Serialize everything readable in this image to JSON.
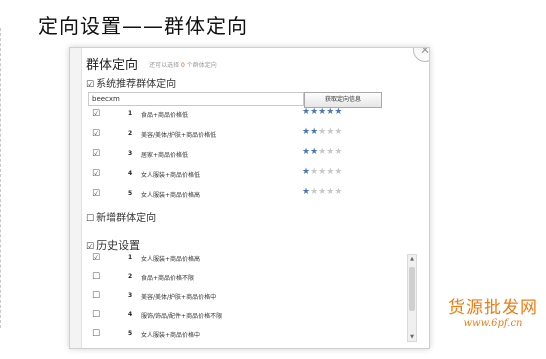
{
  "slide": {
    "title": "定向设置——群体定向"
  },
  "dialog": {
    "title": "群体定向",
    "hint_prefix": "还可以选择",
    "hint_count": "0",
    "hint_suffix": "个群体定向",
    "close_icon": "close-icon",
    "recommend": {
      "checkbox": "☑",
      "label": "系统推荐群体定向",
      "search_value": "beecxm",
      "fetch_button": "获取定向信息",
      "rows": [
        {
          "checkbox": "☑",
          "rank": "1",
          "label": "食品+商品价格低",
          "stars": 5
        },
        {
          "checkbox": "☑",
          "rank": "2",
          "label": "美容/美体/护肤+商品价格低",
          "stars": 2
        },
        {
          "checkbox": "☑",
          "rank": "3",
          "label": "居家+商品价格低",
          "stars": 2
        },
        {
          "checkbox": "☑",
          "rank": "4",
          "label": "女人服装+商品价格低",
          "stars": 1
        },
        {
          "checkbox": "☑",
          "rank": "5",
          "label": "女人服装+商品价格高",
          "stars": 1
        }
      ],
      "max_stars": 5
    },
    "new_group": {
      "checkbox": "☐",
      "label": "新增群体定向"
    },
    "history": {
      "checkbox": "☑",
      "label": "历史设置",
      "rows": [
        {
          "checkbox": "☑",
          "rank": "1",
          "label": "女人服装+商品价格高"
        },
        {
          "checkbox": "☐",
          "rank": "2",
          "label": "食品+商品价格不限"
        },
        {
          "checkbox": "☐",
          "rank": "3",
          "label": "美容/美体/护肤+商品价格中"
        },
        {
          "checkbox": "☐",
          "rank": "4",
          "label": "服饰/饰品/配件+商品价格不限"
        },
        {
          "checkbox": "☐",
          "rank": "5",
          "label": "女人服装+商品价格中"
        }
      ]
    }
  },
  "colors": {
    "star_on": "#4a76b8",
    "star_off": "#c8c8c8",
    "watermark": "#f07b10",
    "hint_count": "#e05a00"
  },
  "watermark": {
    "title": "货源批发网",
    "url": "www.6pf.cn"
  }
}
